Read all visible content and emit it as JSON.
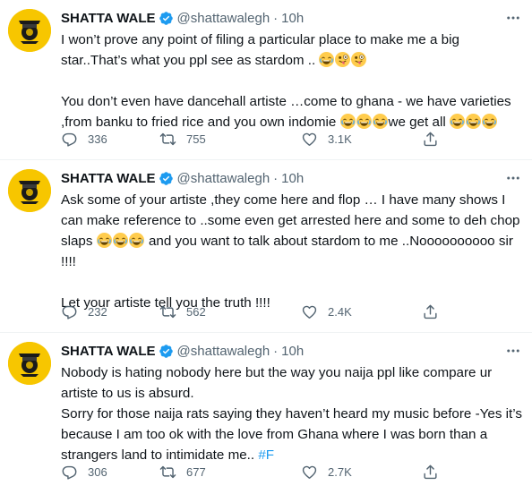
{
  "tweets": [
    {
      "name": "SHATTA WALE",
      "handle": "@shattawalegh",
      "dot": "·",
      "time": "10h",
      "p1_a": "I won’t prove any point of filing a particular place to make me a big star..That’s what you ppl see as stardom ..",
      "p2_a": "You don’t even have dancehall artiste …come to ghana - we have varieties ,from banku to fried rice and you own indomie",
      "p2_b": "we get all",
      "replies": "336",
      "retweets": "755",
      "likes": "3.1K"
    },
    {
      "name": "SHATTA WALE",
      "handle": "@shattawalegh",
      "dot": "·",
      "time": "10h",
      "p1_a": "Ask some of your artiste ,they come here and flop … I have many shows I can make reference to ..some even get arrested here and some to deh chop slaps",
      "p1_b": "and you want to talk about stardom to me ..Noooooooooo sir !!!!",
      "p2_a": "Let your artiste  tell you the truth !!!!",
      "replies": "232",
      "retweets": "562",
      "likes": "2.4K"
    },
    {
      "name": "SHATTA WALE",
      "handle": "@shattawalegh",
      "dot": "·",
      "time": "10h",
      "p1_a": "Nobody is hating nobody here but the way you naija ppl like compare ur artiste to us is absurd.",
      "p1_b": "Sorry for those naija rats saying they haven’t heard my music before -Yes it’s because I am too ok with the love from Ghana where I was born than a strangers land to intimidate me..",
      "hashtag": "#F",
      "replies": "306",
      "retweets": "677",
      "likes": "2.7K"
    }
  ],
  "colors": {
    "accent": "#1d9bf0",
    "muted": "#536471",
    "avatar_bg": "#f7c600"
  },
  "icons": [
    "verified-badge-icon",
    "more-icon",
    "reply-icon",
    "retweet-icon",
    "like-icon",
    "share-icon",
    "laughing-emoji-icon",
    "winking-tongue-emoji-icon"
  ]
}
